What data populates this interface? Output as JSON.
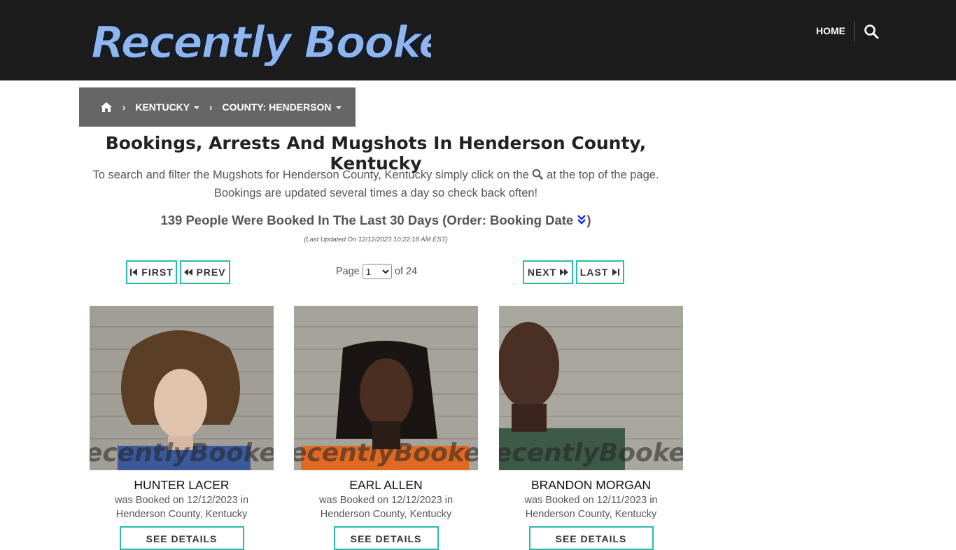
{
  "header": {
    "logo_text": "Recently Booked",
    "nav_home": "HOME",
    "search_icon": "search-icon"
  },
  "breadcrumb": {
    "home_icon": "home-icon",
    "state": "KENTUCKY",
    "county": "COUNTY: HENDERSON"
  },
  "page": {
    "title": "Bookings, Arrests And Mugshots In Henderson County, Kentucky",
    "intro_part1": "To search and filter the Mugshots for Henderson County, Kentucky simply click on the",
    "intro_part2": "at the top of the page.",
    "intro_line2": "Bookings are updated several times a day so check back often!",
    "count_text": "139 People Were Booked In The Last 30 Days (Order: Booking Date",
    "count_close": ")",
    "last_updated": "(Last Updated On 12/12/2023 10:22:18 AM EST)"
  },
  "pagination": {
    "first": "FIRST",
    "prev": "PREV",
    "next": "NEXT",
    "last": "LAST",
    "page_label": "Page",
    "current_page": "1",
    "of_label": "of 24"
  },
  "watermark": "ecentlyBooked.co",
  "cards": [
    {
      "name": "HUNTER LACER",
      "line1": "was Booked on 12/12/2023 in",
      "line2": "Henderson County, Kentucky",
      "button": "SEE DETAILS"
    },
    {
      "name": "EARL ALLEN",
      "line1": "was Booked on 12/12/2023 in",
      "line2": "Henderson County, Kentucky",
      "button": "SEE DETAILS"
    },
    {
      "name": "BRANDON MORGAN",
      "line1": "was Booked on 12/11/2023 in",
      "line2": "Henderson County, Kentucky",
      "button": "SEE DETAILS"
    }
  ],
  "colors": {
    "header_bg": "#1c1c1c",
    "breadcrumb_bg": "#666666",
    "accent_teal": "#2bbbad",
    "logo_blue": "#8fb6ec"
  }
}
